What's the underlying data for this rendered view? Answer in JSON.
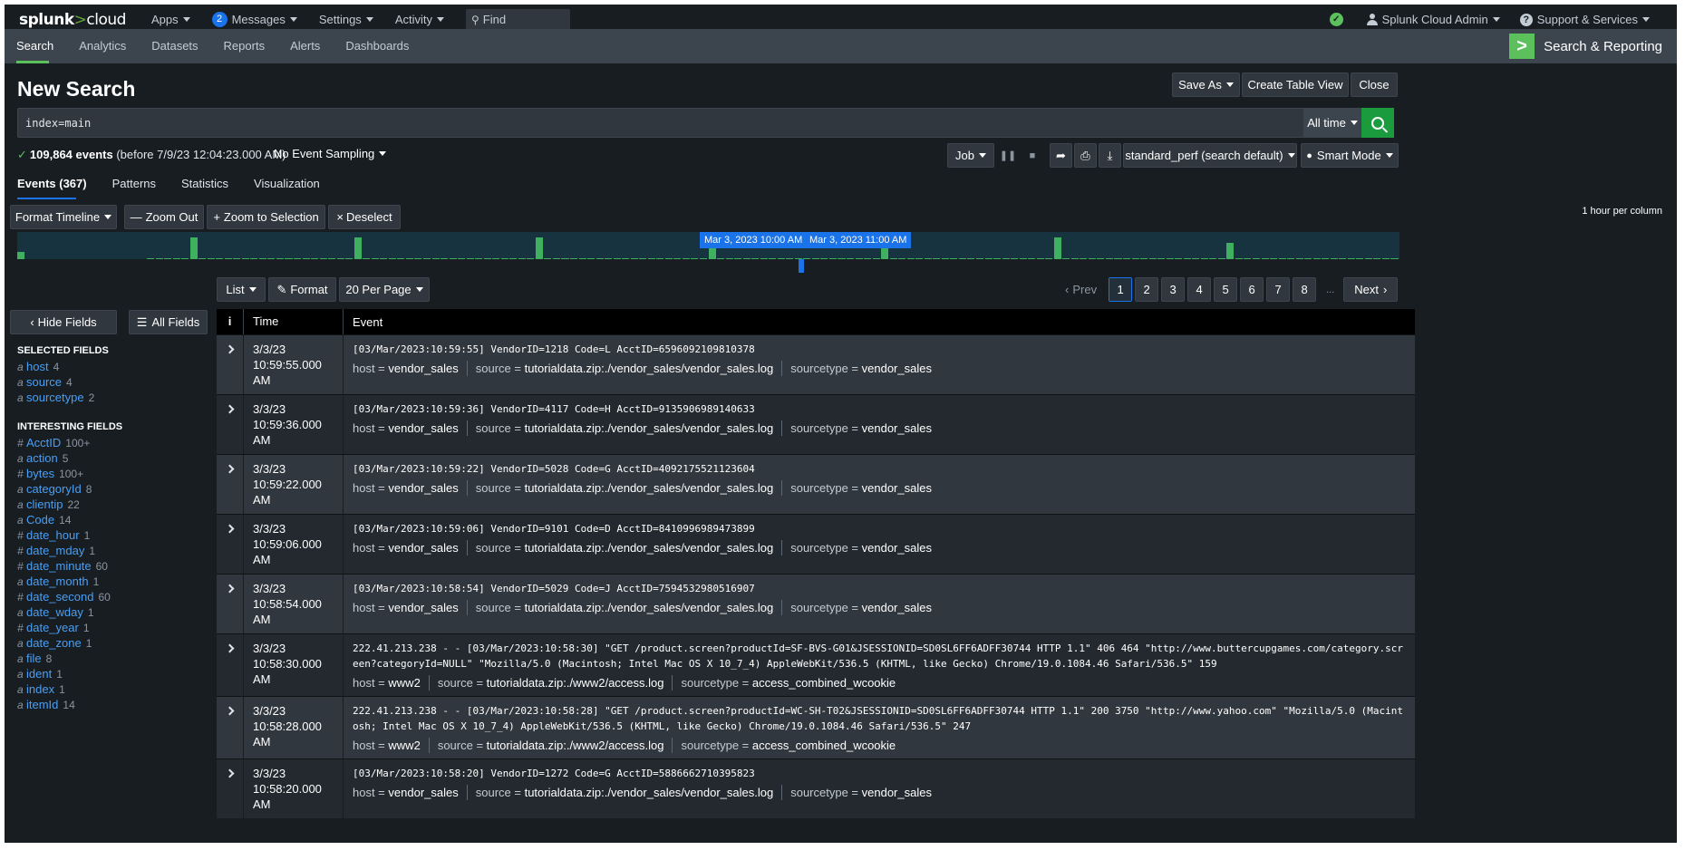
{
  "topbar": {
    "logo_brand": "splunk",
    "logo_gt": ">",
    "logo_product": "cloud",
    "apps_label": "Apps",
    "messages_count": "2",
    "messages_label": "Messages",
    "settings_label": "Settings",
    "activity_label": "Activity",
    "find_placeholder": "Find",
    "user_label": "Splunk Cloud Admin",
    "support_label": "Support & Services"
  },
  "appbar": {
    "tabs": [
      "Search",
      "Analytics",
      "Datasets",
      "Reports",
      "Alerts",
      "Dashboards"
    ],
    "app_name": "Search & Reporting"
  },
  "page": {
    "title": "New Search",
    "save_as": "Save As",
    "create_table_view": "Create Table View",
    "close": "Close"
  },
  "search": {
    "query": "index=main",
    "time_range": "All time",
    "event_count": "109,864 events",
    "event_suffix": "(before 7/9/23 12:04:23.000 AM)",
    "sampling": "No Event Sampling",
    "job": "Job",
    "perf": "standard_perf (search default)",
    "mode": "Smart Mode"
  },
  "result_tabs": [
    "Events (367)",
    "Patterns",
    "Statistics",
    "Visualization"
  ],
  "timeline": {
    "format_label": "Format Timeline",
    "zoom_out": "Zoom Out",
    "zoom_selection": "Zoom to Selection",
    "deselect": "Deselect",
    "hour_per_column": "1 hour per column",
    "label_left": "Mar 3, 2023 10:00 AM",
    "label_right": "Mar 3, 2023 11:00 AM"
  },
  "list_controls": {
    "list": "List",
    "format": "Format",
    "per_page": "20 Per Page",
    "prev": "Prev",
    "next": "Next",
    "pages": [
      "1",
      "2",
      "3",
      "4",
      "5",
      "6",
      "7",
      "8"
    ],
    "ellipsis": "...",
    "current_page": "1"
  },
  "sidebar": {
    "hide_fields": "Hide Fields",
    "all_fields": "All Fields",
    "selected_header": "SELECTED FIELDS",
    "interesting_header": "INTERESTING FIELDS",
    "selected": [
      {
        "type": "a",
        "name": "host",
        "count": "4"
      },
      {
        "type": "a",
        "name": "source",
        "count": "4"
      },
      {
        "type": "a",
        "name": "sourcetype",
        "count": "2"
      }
    ],
    "interesting": [
      {
        "type": "#",
        "name": "AcctID",
        "count": "100+"
      },
      {
        "type": "a",
        "name": "action",
        "count": "5"
      },
      {
        "type": "#",
        "name": "bytes",
        "count": "100+"
      },
      {
        "type": "a",
        "name": "categoryId",
        "count": "8"
      },
      {
        "type": "a",
        "name": "clientip",
        "count": "22"
      },
      {
        "type": "a",
        "name": "Code",
        "count": "14"
      },
      {
        "type": "#",
        "name": "date_hour",
        "count": "1"
      },
      {
        "type": "#",
        "name": "date_mday",
        "count": "1"
      },
      {
        "type": "#",
        "name": "date_minute",
        "count": "60"
      },
      {
        "type": "a",
        "name": "date_month",
        "count": "1"
      },
      {
        "type": "#",
        "name": "date_second",
        "count": "60"
      },
      {
        "type": "a",
        "name": "date_wday",
        "count": "1"
      },
      {
        "type": "#",
        "name": "date_year",
        "count": "1"
      },
      {
        "type": "a",
        "name": "date_zone",
        "count": "1"
      },
      {
        "type": "a",
        "name": "file",
        "count": "8"
      },
      {
        "type": "a",
        "name": "ident",
        "count": "1"
      },
      {
        "type": "a",
        "name": "index",
        "count": "1"
      },
      {
        "type": "a",
        "name": "itemId",
        "count": "14"
      }
    ]
  },
  "table": {
    "col_info": "i",
    "col_time": "Time",
    "col_event": "Event",
    "meta_keys": {
      "host": "host =",
      "source": "source =",
      "sourcetype": "sourcetype ="
    },
    "events": [
      {
        "date": "3/3/23",
        "time": "10:59:55.000 AM",
        "raw": "[03/Mar/2023:10:59:55] VendorID=1218 Code=L AcctID=6596092109810378",
        "host": "vendor_sales",
        "source": "tutorialdata.zip:./vendor_sales/vendor_sales.log",
        "sourcetype": "vendor_sales"
      },
      {
        "date": "3/3/23",
        "time": "10:59:36.000 AM",
        "raw": "[03/Mar/2023:10:59:36] VendorID=4117 Code=H AcctID=9135906989140633",
        "host": "vendor_sales",
        "source": "tutorialdata.zip:./vendor_sales/vendor_sales.log",
        "sourcetype": "vendor_sales"
      },
      {
        "date": "3/3/23",
        "time": "10:59:22.000 AM",
        "raw": "[03/Mar/2023:10:59:22] VendorID=5028 Code=G AcctID=4092175521123604",
        "host": "vendor_sales",
        "source": "tutorialdata.zip:./vendor_sales/vendor_sales.log",
        "sourcetype": "vendor_sales"
      },
      {
        "date": "3/3/23",
        "time": "10:59:06.000 AM",
        "raw": "[03/Mar/2023:10:59:06] VendorID=9101 Code=D AcctID=8410996989473899",
        "host": "vendor_sales",
        "source": "tutorialdata.zip:./vendor_sales/vendor_sales.log",
        "sourcetype": "vendor_sales"
      },
      {
        "date": "3/3/23",
        "time": "10:58:54.000 AM",
        "raw": "[03/Mar/2023:10:58:54] VendorID=5029 Code=J AcctID=7594532980516907",
        "host": "vendor_sales",
        "source": "tutorialdata.zip:./vendor_sales/vendor_sales.log",
        "sourcetype": "vendor_sales"
      },
      {
        "date": "3/3/23",
        "time": "10:58:30.000 AM",
        "raw": "222.41.213.238 - - [03/Mar/2023:10:58:30] \"GET /product.screen?productId=SF-BVS-G01&JSESSIONID=SD0SL6FF6ADFF30744 HTTP 1.1\" 406 464 \"http://www.buttercupgames.com/category.screen?categoryId=NULL\" \"Mozilla/5.0 (Macintosh; Intel Mac OS X 10_7_4) AppleWebKit/536.5 (KHTML, like Gecko) Chrome/19.0.1084.46 Safari/536.5\" 159",
        "host": "www2",
        "source": "tutorialdata.zip:./www2/access.log",
        "sourcetype": "access_combined_wcookie"
      },
      {
        "date": "3/3/23",
        "time": "10:58:28.000 AM",
        "raw": "222.41.213.238 - - [03/Mar/2023:10:58:28] \"GET /product.screen?productId=WC-SH-T02&JSESSIONID=SD0SL6FF6ADFF30744 HTTP 1.1\" 200 3750 \"http://www.yahoo.com\" \"Mozilla/5.0 (Macintosh; Intel Mac OS X 10_7_4) AppleWebKit/536.5 (KHTML, like Gecko) Chrome/19.0.1084.46 Safari/536.5\" 247",
        "host": "www2",
        "source": "tutorialdata.zip:./www2/access.log",
        "sourcetype": "access_combined_wcookie"
      },
      {
        "date": "3/3/23",
        "time": "10:58:20.000 AM",
        "raw": "[03/Mar/2023:10:58:20] VendorID=1272 Code=G AcctID=5886662710395823",
        "host": "vendor_sales",
        "source": "tutorialdata.zip:./vendor_sales/vendor_sales.log",
        "sourcetype": "vendor_sales"
      }
    ]
  },
  "colors": {
    "accent_green": "#5cc05c",
    "accent_blue": "#1a73e8",
    "field_link": "#4a9ff5",
    "background": "#171d21"
  }
}
